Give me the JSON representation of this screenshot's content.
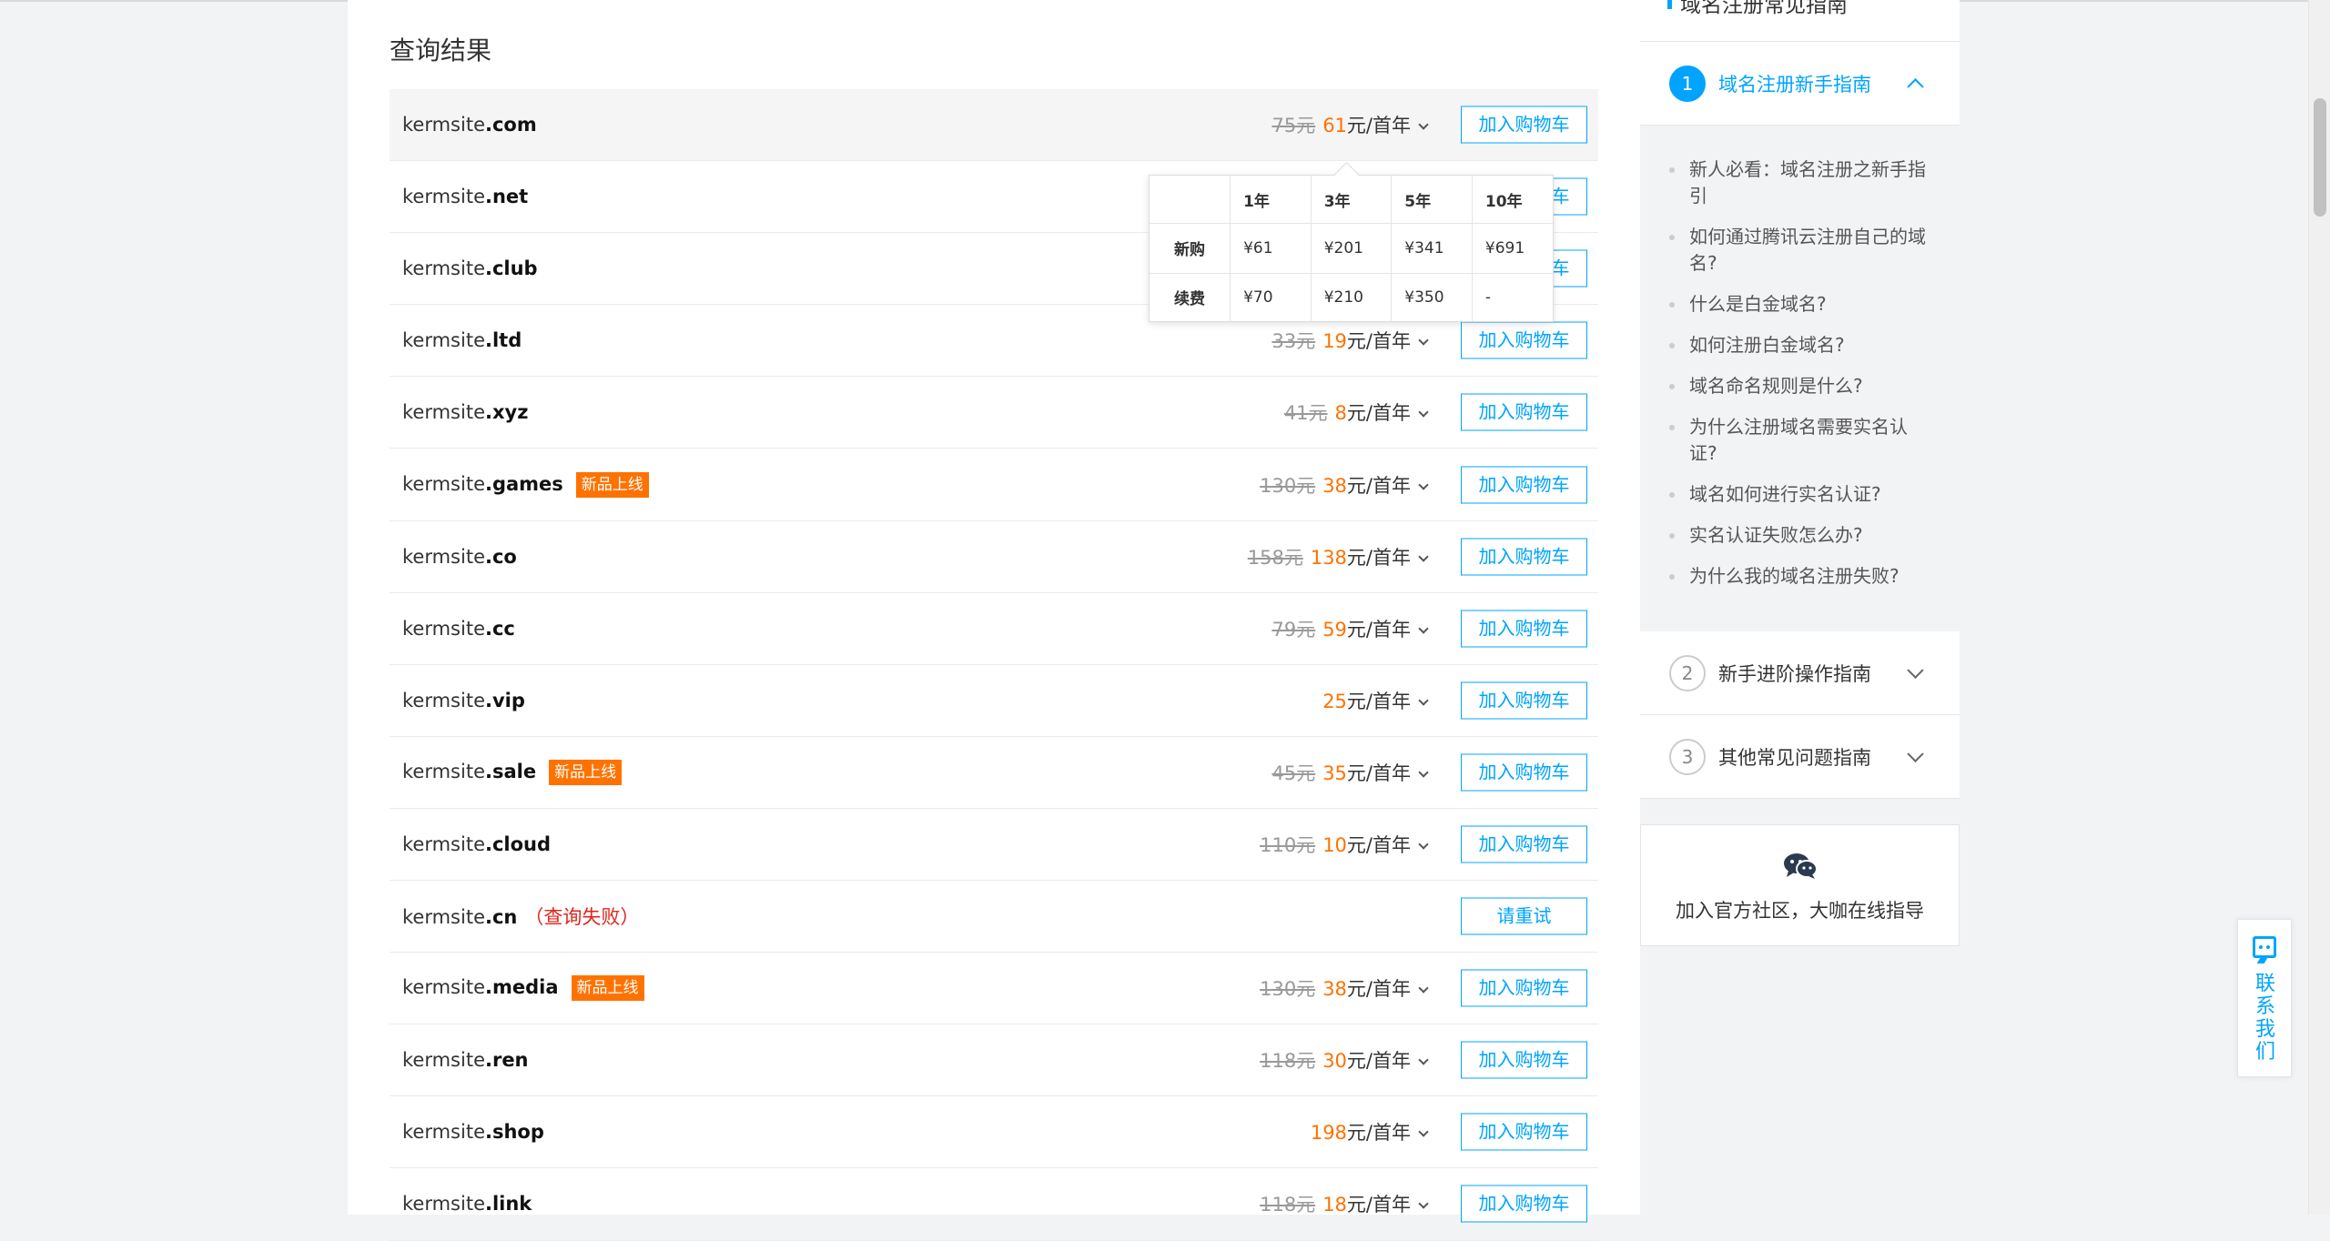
{
  "results": {
    "title": "查询结果",
    "rows": [
      {
        "prefix": "kermsite",
        "tld": ".com",
        "badge": "",
        "fail": "",
        "orig": "75元",
        "price": "61",
        "unit": "元/首年",
        "button": "加入购物车",
        "hover": true
      },
      {
        "prefix": "kermsite",
        "tld": ".net",
        "badge": "",
        "fail": "",
        "orig": "",
        "price": "",
        "unit": "",
        "button": "加入购物车",
        "hover": false
      },
      {
        "prefix": "kermsite",
        "tld": ".club",
        "badge": "",
        "fail": "",
        "orig": "",
        "price": "",
        "unit": "",
        "button": "加入购物车",
        "hover": false
      },
      {
        "prefix": "kermsite",
        "tld": ".ltd",
        "badge": "",
        "fail": "",
        "orig": "33元",
        "price": "19",
        "unit": "元/首年",
        "button": "加入购物车",
        "hover": false
      },
      {
        "prefix": "kermsite",
        "tld": ".xyz",
        "badge": "",
        "fail": "",
        "orig": "41元",
        "price": "8",
        "unit": "元/首年",
        "button": "加入购物车",
        "hover": false
      },
      {
        "prefix": "kermsite",
        "tld": ".games",
        "badge": "新品上线",
        "fail": "",
        "orig": "130元",
        "price": "38",
        "unit": "元/首年",
        "button": "加入购物车",
        "hover": false
      },
      {
        "prefix": "kermsite",
        "tld": ".co",
        "badge": "",
        "fail": "",
        "orig": "158元",
        "price": "138",
        "unit": "元/首年",
        "button": "加入购物车",
        "hover": false
      },
      {
        "prefix": "kermsite",
        "tld": ".cc",
        "badge": "",
        "fail": "",
        "orig": "79元",
        "price": "59",
        "unit": "元/首年",
        "button": "加入购物车",
        "hover": false
      },
      {
        "prefix": "kermsite",
        "tld": ".vip",
        "badge": "",
        "fail": "",
        "orig": "",
        "price": "25",
        "unit": "元/首年",
        "button": "加入购物车",
        "hover": false
      },
      {
        "prefix": "kermsite",
        "tld": ".sale",
        "badge": "新品上线",
        "fail": "",
        "orig": "45元",
        "price": "35",
        "unit": "元/首年",
        "button": "加入购物车",
        "hover": false
      },
      {
        "prefix": "kermsite",
        "tld": ".cloud",
        "badge": "",
        "fail": "",
        "orig": "110元",
        "price": "10",
        "unit": "元/首年",
        "button": "加入购物车",
        "hover": false
      },
      {
        "prefix": "kermsite",
        "tld": ".cn",
        "badge": "",
        "fail": "（查询失败）",
        "orig": "",
        "price": "",
        "unit": "",
        "button": "请重试",
        "hover": false
      },
      {
        "prefix": "kermsite",
        "tld": ".media",
        "badge": "新品上线",
        "fail": "",
        "orig": "130元",
        "price": "38",
        "unit": "元/首年",
        "button": "加入购物车",
        "hover": false
      },
      {
        "prefix": "kermsite",
        "tld": ".ren",
        "badge": "",
        "fail": "",
        "orig": "118元",
        "price": "30",
        "unit": "元/首年",
        "button": "加入购物车",
        "hover": false
      },
      {
        "prefix": "kermsite",
        "tld": ".shop",
        "badge": "",
        "fail": "",
        "orig": "",
        "price": "198",
        "unit": "元/首年",
        "button": "加入购物车",
        "hover": false
      },
      {
        "prefix": "kermsite",
        "tld": ".link",
        "badge": "",
        "fail": "",
        "orig": "118元",
        "price": "18",
        "unit": "元/首年",
        "button": "加入购物车",
        "hover": false
      }
    ]
  },
  "popup": {
    "headers": [
      "",
      "1年",
      "3年",
      "5年",
      "10年"
    ],
    "rows": [
      [
        "新购",
        "¥61",
        "¥201",
        "¥341",
        "¥691"
      ],
      [
        "续费",
        "¥70",
        "¥210",
        "¥350",
        "-"
      ]
    ]
  },
  "sidebar": {
    "top_title": "域名注册常见指南",
    "guides": [
      {
        "num": "1",
        "title": "域名注册新手指南",
        "active": true
      },
      {
        "num": "2",
        "title": "新手进阶操作指南",
        "active": false
      },
      {
        "num": "3",
        "title": "其他常见问题指南",
        "active": false
      }
    ],
    "items": [
      "新人必看：域名注册之新手指引",
      "如何通过腾讯云注册自己的域名?",
      "什么是白金域名?",
      "如何注册白金域名?",
      "域名命名规则是什么?",
      "为什么注册域名需要实名认证?",
      "域名如何进行实名认证?",
      "实名认证失败怎么办?",
      "为什么我的域名注册失败?"
    ],
    "community": {
      "text": "加入官方社区，大咖在线指导",
      "icon": "wechat-icon"
    }
  },
  "contact": {
    "label": "联系我们",
    "icon": "chat-icon"
  },
  "colors": {
    "accent": "#00a4ff",
    "price": "#ff7200",
    "badge": "#ff7200",
    "fail": "#e1251b"
  }
}
